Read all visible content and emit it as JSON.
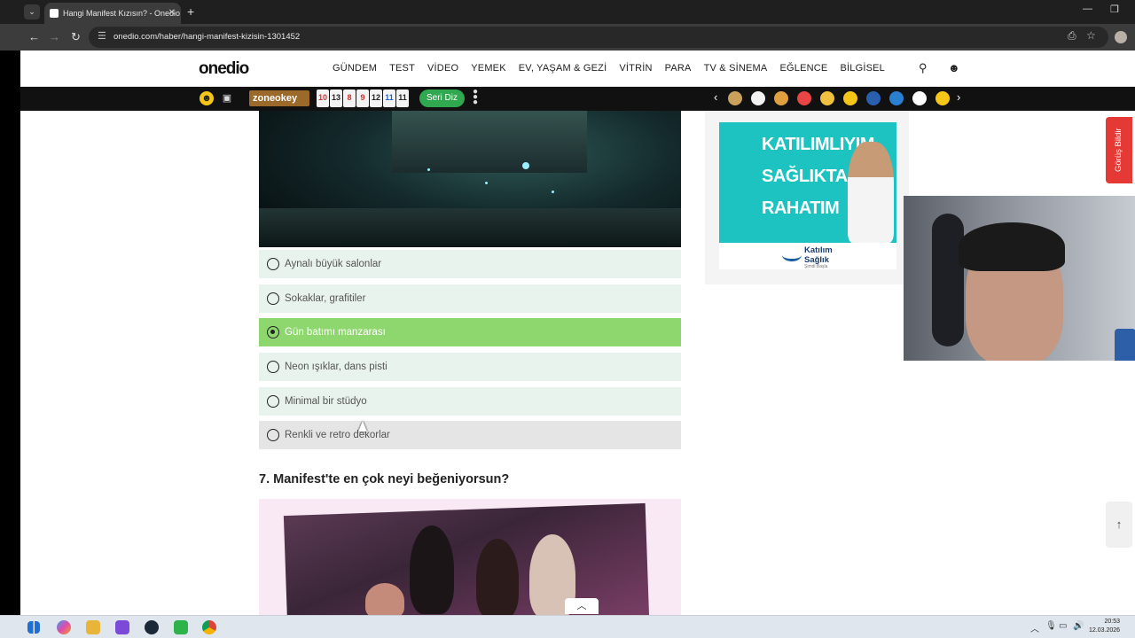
{
  "browser": {
    "tab_title": "Hangi Manifest Kızısın? - Onedio",
    "url": "onedio.com/haber/hangi-manifest-kizisin-1301452",
    "tab_search_icon": "chevron-down",
    "new_tab_label": "+",
    "close_tab_label": "✕"
  },
  "site": {
    "logo": "onedio",
    "nav": [
      "GÜNDEM",
      "TEST",
      "VİDEO",
      "YEMEK",
      "EV, YAŞAM & GEZİ",
      "VİTRİN",
      "PARA",
      "TV & SİNEMA",
      "EĞLENCE",
      "BİLGİSEL"
    ]
  },
  "strip": {
    "zone": "zoneokey",
    "tiles": [
      {
        "n": "10",
        "color": "#d32f2f"
      },
      {
        "n": "13",
        "color": "#222222"
      },
      {
        "n": "8",
        "color": "#d32f2f"
      },
      {
        "n": "9",
        "color": "#d32f2f"
      },
      {
        "n": "12",
        "color": "#222222"
      },
      {
        "n": "11",
        "color": "#1e63c9"
      },
      {
        "n": "11",
        "color": "#222222"
      }
    ],
    "seri_label": "Seri Diz"
  },
  "question": {
    "options": [
      {
        "label": "Aynalı büyük salonlar",
        "selected": false
      },
      {
        "label": "Sokaklar, grafitiler",
        "selected": false
      },
      {
        "label": "Gün batımı manzarası",
        "selected": true
      },
      {
        "label": "Neon ışıklar, dans pisti",
        "selected": false
      },
      {
        "label": "Minimal bir stüdyo",
        "selected": false
      },
      {
        "label": "Renkli ve retro dekorlar",
        "selected": false,
        "hovered": true
      }
    ],
    "next_title": "7. Manifest'te en çok neyi beğeniyorsun?"
  },
  "ad": {
    "lines": [
      "KATILIMLIYIM",
      "SAĞLIKTA",
      "RAHATIM"
    ],
    "brand_line1": "Katılım",
    "brand_line2": "Sağlık",
    "brand_sub": "Şimdi Başla"
  },
  "feedback_label": "Görüş Bildir",
  "taskbar": {
    "time": "20:53",
    "date": "12.03.2026"
  },
  "colors": {
    "selected_option": "#8ed76e",
    "option_bg": "#e9f3ee",
    "ad_teal": "#1cc3c1",
    "feedback": "#e53935",
    "seri_button": "#2fa84f"
  }
}
